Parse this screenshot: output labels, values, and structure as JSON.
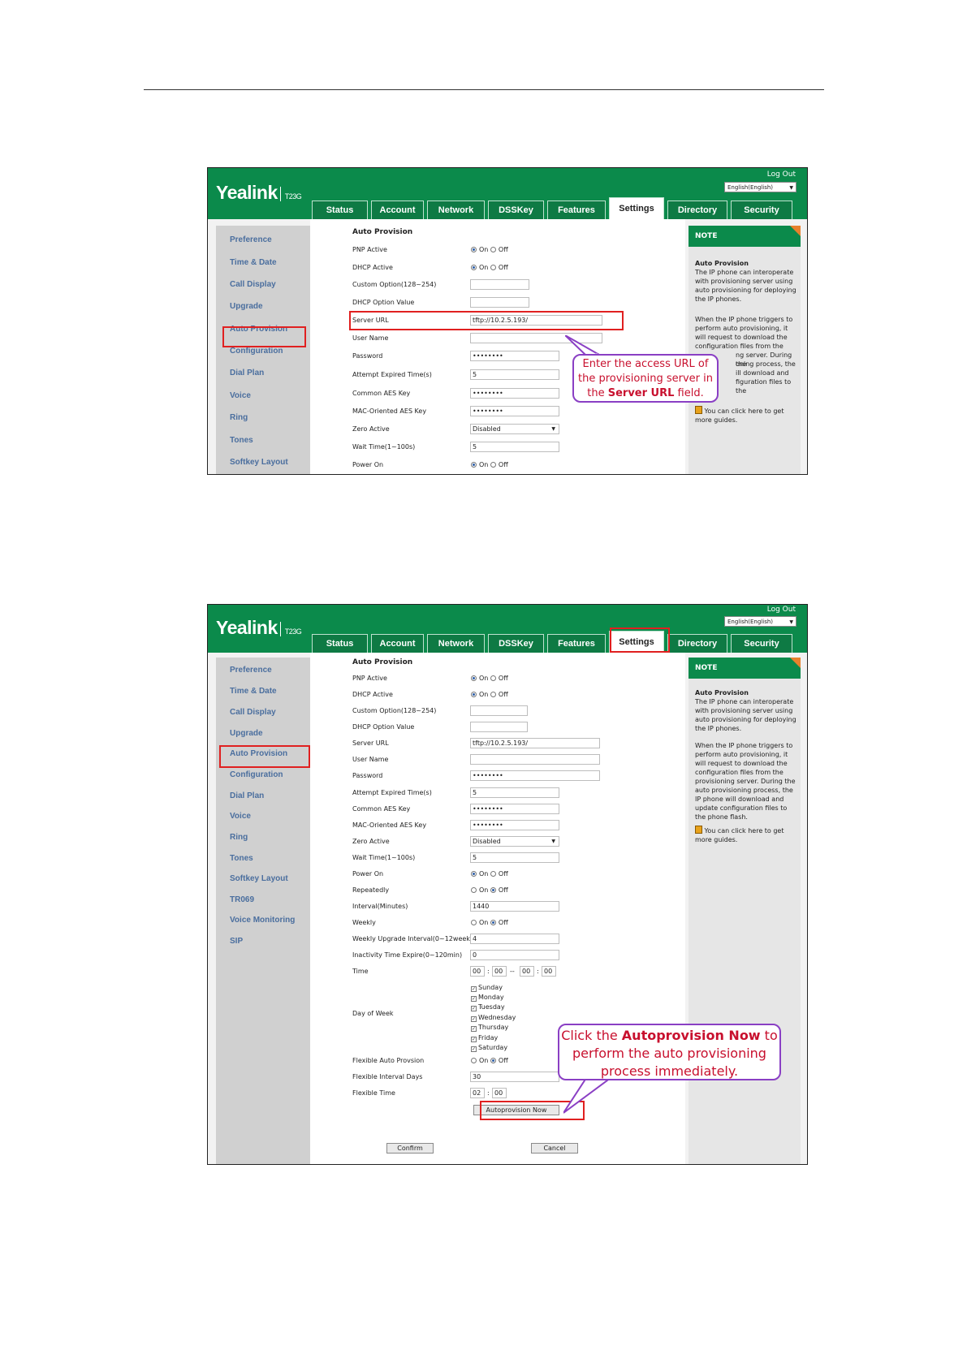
{
  "app": {
    "logo": "Yealink",
    "model": "T23G",
    "logout": "Log Out",
    "language": "English(English)"
  },
  "tabs": [
    "Status",
    "Account",
    "Network",
    "DSSKey",
    "Features",
    "Settings",
    "Directory",
    "Security"
  ],
  "active_tab": "Settings",
  "sidebar": [
    "Preference",
    "Time & Date",
    "Call Display",
    "Upgrade",
    "Auto Provision",
    "Configuration",
    "Dial Plan",
    "Voice",
    "Ring",
    "Tones",
    "Softkey Layout",
    "TR069",
    "Voice Monitoring",
    "SIP"
  ],
  "section_title": "Auto Provision",
  "fields": {
    "pnp_active": "PNP Active",
    "dhcp_active": "DHCP Active",
    "custom_option": "Custom Option(128~254)",
    "dhcp_option_value": "DHCP Option Value",
    "server_url": "Server URL",
    "server_url_value": "tftp://10.2.5.193/",
    "user_name": "User Name",
    "password": "Password",
    "password_value": "••••••••",
    "attempt_expired": "Attempt Expired Time(s)",
    "attempt_expired_value": "5",
    "common_aes": "Common AES Key",
    "common_aes_value": "••••••••",
    "mac_aes": "MAC-Oriented AES Key",
    "mac_aes_value": "••••••••",
    "zero_active": "Zero Active",
    "zero_active_value": "Disabled",
    "wait_time": "Wait Time(1~100s)",
    "wait_time_value": "5",
    "power_on": "Power On",
    "repeatedly": "Repeatedly",
    "interval": "Interval(Minutes)",
    "interval_value": "1440",
    "weekly": "Weekly",
    "weekly_interval": "Weekly Upgrade Interval(0~12week)",
    "weekly_interval_value": "4",
    "inactivity": "Inactivity Time Expire(0~120min)",
    "inactivity_value": "0",
    "time": "Time",
    "time_h1": "00",
    "time_m1": "00",
    "time_dash": "--",
    "time_h2": "00",
    "time_m2": "00",
    "time_sep": ":",
    "day_of_week": "Day of Week",
    "days": [
      "Sunday",
      "Monday",
      "Tuesday",
      "Wednesday",
      "Thursday",
      "Friday",
      "Saturday"
    ],
    "flexible_auto": "Flexible Auto Provsion",
    "flexible_days": "Flexible Interval Days",
    "flexible_days_value": "30",
    "flexible_time": "Flexible Time",
    "flexible_time_h": "02",
    "flexible_time_m": "00"
  },
  "radio": {
    "on": "On",
    "off": "Off",
    "check": "✓"
  },
  "buttons": {
    "autoprovision_now": "Autoprovision Now",
    "confirm": "Confirm",
    "cancel": "Cancel"
  },
  "note": {
    "header": "NOTE",
    "title": "Auto Provision",
    "p1": "The IP phone can interoperate with provisioning server using auto provisioning for deploying the IP phones.",
    "p2": "When the IP phone triggers to perform auto provisioning, it will request to download the configuration files from the provisioning server. During the auto provisioning process, the IP phone will download and update configuration files to the phone flash.",
    "p3": "You can click here to get more guides.",
    "p2_visible_1": "When the IP phone triggers to perform auto provisioning, it will request to download the configuration files from the",
    "p2_visible_2": "ng server. During the",
    "p2_visible_3": "oning process, the",
    "p2_visible_4": "ill download and",
    "p2_visible_5": "figuration files to the"
  },
  "callouts": {
    "c1_pre": "Enter the access URL of the provisioning server in the ",
    "c1_bold": "Server URL",
    "c1_post": " field.",
    "c2_pre": "Click the ",
    "c2_bold": "Autoprovision Now",
    "c2_post": " to perform the auto provisioning process immediately."
  },
  "colors": {
    "header_green": "#0b8a4b",
    "tab_green": "#0e7a44",
    "highlight_red": "#e02020",
    "callout_border": "#8a3fc4",
    "callout_text": "#c8102e",
    "note_corner": "#e8812d",
    "sidebar_text": "#4a6e9e"
  }
}
